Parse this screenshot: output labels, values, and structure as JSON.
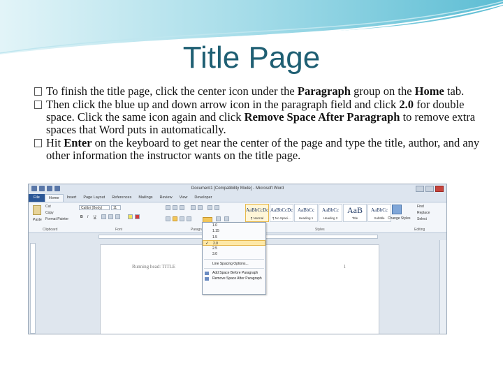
{
  "slide": {
    "title": "Title Page",
    "bullets": [
      {
        "parts": [
          "To finish the title page, click the center icon under the ",
          "Paragraph",
          " group on the ",
          "Home",
          " tab."
        ]
      },
      {
        "parts": [
          "Then click the blue up and down arrow icon in the paragraph field and click ",
          "2.0",
          " for double space.  Click the same icon again and click ",
          "Remove Space After Paragraph",
          " to remove extra spaces that Word puts in automatically."
        ]
      },
      {
        "parts": [
          "Hit ",
          "Enter",
          " on the keyboard to get near the center of the page and type the title, author, and any other information the instructor wants on the title page."
        ]
      }
    ]
  },
  "word": {
    "window_title": "Document1 [Compatibility Mode] - Microsoft Word",
    "tabs": [
      "File",
      "Home",
      "Insert",
      "Page Layout",
      "References",
      "Mailings",
      "Review",
      "View",
      "Developer"
    ],
    "clipboard": {
      "paste": "Paste",
      "cut": "Cut",
      "copy": "Copy",
      "format_painter": "Format Painter"
    },
    "font": {
      "name": "Calibri (Body)",
      "size": "11"
    },
    "group_labels": [
      "Clipboard",
      "Font",
      "Paragraph",
      "Styles",
      "Editing"
    ],
    "styles": [
      {
        "sample": "AaBbCcDc",
        "name": "¶ Normal"
      },
      {
        "sample": "AaBbCcDc",
        "name": "¶ No Spaci..."
      },
      {
        "sample": "AaBbCc",
        "name": "Heading 1"
      },
      {
        "sample": "AaBbCc",
        "name": "Heading 2"
      },
      {
        "sample": "AaB",
        "name": "Title"
      },
      {
        "sample": "AaBbCc",
        "name": "Subtitle"
      }
    ],
    "change_styles": "Change Styles",
    "editing": {
      "find": "Find",
      "replace": "Replace",
      "select": "Select"
    },
    "line_spacing_menu": {
      "options": [
        "1.0",
        "1.15",
        "1.5",
        "2.0",
        "2.5",
        "3.0"
      ],
      "selected": "2.0",
      "more": "Line Spacing Options...",
      "add_before": "Add Space Before Paragraph",
      "remove_after": "Remove Space After Paragraph"
    },
    "document": {
      "running_head": "Running head: TITLE",
      "page_number": "1"
    }
  }
}
